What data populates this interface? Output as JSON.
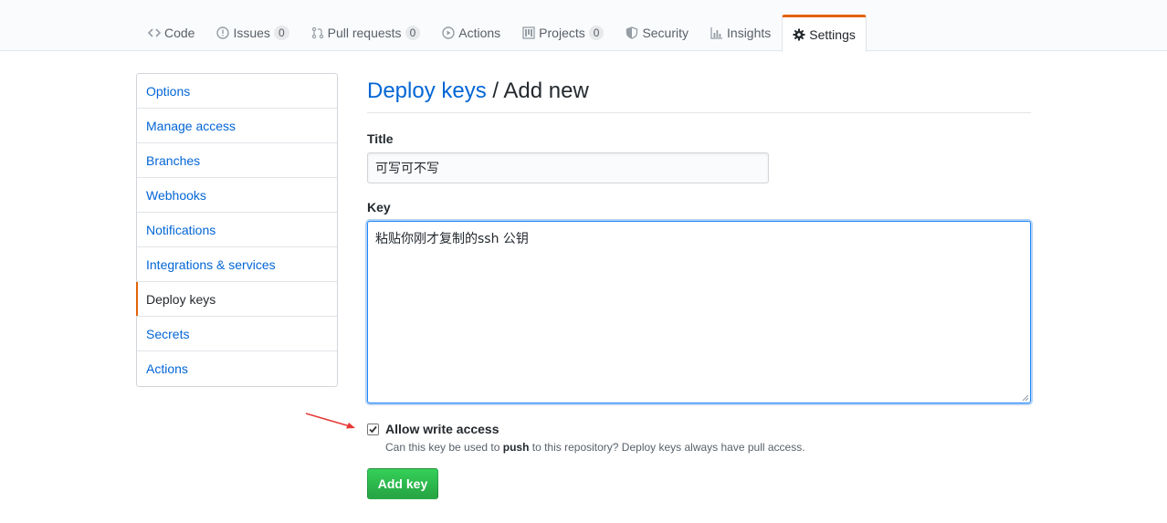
{
  "tabs": [
    {
      "label": "Code",
      "icon": "code-icon",
      "counter": null
    },
    {
      "label": "Issues",
      "icon": "issue-icon",
      "counter": "0"
    },
    {
      "label": "Pull requests",
      "icon": "pull-request-icon",
      "counter": "0"
    },
    {
      "label": "Actions",
      "icon": "play-icon",
      "counter": null
    },
    {
      "label": "Projects",
      "icon": "project-icon",
      "counter": "0"
    },
    {
      "label": "Security",
      "icon": "shield-icon",
      "counter": null
    },
    {
      "label": "Insights",
      "icon": "graph-icon",
      "counter": null
    },
    {
      "label": "Settings",
      "icon": "gear-icon",
      "counter": null,
      "selected": true
    }
  ],
  "sidebar": {
    "items": [
      {
        "label": "Options"
      },
      {
        "label": "Manage access"
      },
      {
        "label": "Branches"
      },
      {
        "label": "Webhooks"
      },
      {
        "label": "Notifications"
      },
      {
        "label": "Integrations & services"
      },
      {
        "label": "Deploy keys",
        "active": true
      },
      {
        "label": "Secrets"
      },
      {
        "label": "Actions"
      }
    ]
  },
  "main": {
    "breadcrumb_link": "Deploy keys",
    "breadcrumb_separator": " / ",
    "breadcrumb_current": "Add new",
    "title_label": "Title",
    "title_value": "可写可不写",
    "key_label": "Key",
    "key_value": "粘贴你刚才复制的ssh 公钥",
    "write_access": {
      "checked": true,
      "label": "Allow write access",
      "note_before": "Can this key be used to ",
      "note_bold": "push",
      "note_after": " to this repository? Deploy keys always have pull access."
    },
    "submit_label": "Add key"
  },
  "colors": {
    "accent_orange": "#e36209",
    "link_blue": "#0366d6",
    "button_green": "#28a745",
    "annotation_red": "#e53935"
  }
}
